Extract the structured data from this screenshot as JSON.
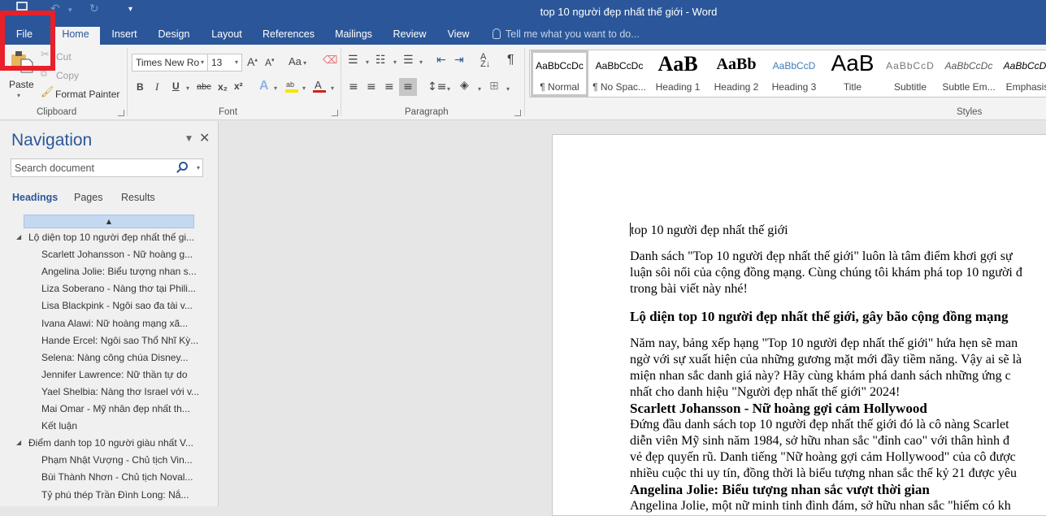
{
  "window": {
    "title": "top 10 người đẹp nhất thế giới - Word"
  },
  "quick_access": {
    "save_icon": "save-icon",
    "undo_icon": "undo-icon",
    "redo_icon": "redo-icon",
    "customize_icon": "customize-quick-access-icon"
  },
  "tabs": [
    {
      "label": "File",
      "active": false
    },
    {
      "label": "Home",
      "active": true
    },
    {
      "label": "Insert",
      "active": false
    },
    {
      "label": "Design",
      "active": false
    },
    {
      "label": "Layout",
      "active": false
    },
    {
      "label": "References",
      "active": false
    },
    {
      "label": "Mailings",
      "active": false
    },
    {
      "label": "Review",
      "active": false
    },
    {
      "label": "View",
      "active": false
    }
  ],
  "tell_me": {
    "placeholder": "Tell me what you want to do..."
  },
  "ribbon": {
    "clipboard": {
      "paste": "Paste",
      "cut": "Cut",
      "copy": "Copy",
      "format_painter": "Format Painter",
      "label": "Clipboard"
    },
    "font": {
      "font_name": "Times New Ro",
      "font_size": "13",
      "change_case": "Aa",
      "bold": "B",
      "italic": "I",
      "underline": "U",
      "strikethrough": "abc",
      "subscript": "x₂",
      "superscript": "x²",
      "highlight_color": "#f2e600",
      "font_color": "#d21f1f",
      "label": "Font"
    },
    "paragraph": {
      "label": "Paragraph",
      "show_marks": "¶"
    },
    "styles": {
      "label": "Styles",
      "items": [
        {
          "preview": "AaBbCcDc",
          "name": "¶ Normal",
          "selected": true
        },
        {
          "preview": "AaBbCcDc",
          "name": "¶ No Spac...",
          "selected": false
        },
        {
          "preview": "AaB",
          "name": "Heading 1",
          "selected": false
        },
        {
          "preview": "AaBb",
          "name": "Heading 2",
          "selected": false
        },
        {
          "preview": "AaBbCcD",
          "name": "Heading 3",
          "selected": false
        },
        {
          "preview": "AaB",
          "name": "Title",
          "selected": false
        },
        {
          "preview": "AaBbCcD",
          "name": "Subtitle",
          "selected": false
        },
        {
          "preview": "AaBbCcDc",
          "name": "Subtle Em...",
          "selected": false
        },
        {
          "preview": "AaBbCcDc",
          "name": "Emphasis",
          "selected": false
        }
      ]
    }
  },
  "navigation": {
    "title": "Navigation",
    "search_placeholder": "Search document",
    "tabs": [
      {
        "label": "Headings",
        "active": true
      },
      {
        "label": "Pages",
        "active": false
      },
      {
        "label": "Results",
        "active": false
      }
    ],
    "headings": [
      {
        "text": "Lộ diện top 10 người đẹp nhất thế gi...",
        "level": 1,
        "expanded": true
      },
      {
        "text": "Scarlett Johansson - Nữ hoàng g...",
        "level": 2
      },
      {
        "text": "Angelina Jolie: Biểu tượng nhan s...",
        "level": 2
      },
      {
        "text": "Liza Soberano - Nàng thơ tại Phili...",
        "level": 2
      },
      {
        "text": "Lisa Blackpink - Ngôi sao đa tài v...",
        "level": 2
      },
      {
        "text": "Ivana Alawi: Nữ hoàng mạng xã...",
        "level": 2
      },
      {
        "text": "Hande Ercel: Ngôi sao Thổ Nhĩ Kỳ...",
        "level": 2
      },
      {
        "text": "Selena: Nàng công chúa Disney...",
        "level": 2
      },
      {
        "text": "Jennifer Lawrence: Nữ thần tự do",
        "level": 2
      },
      {
        "text": "Yael Shelbia: Nàng thơ Israel với v...",
        "level": 2
      },
      {
        "text": "Mai Omar - Mỹ nhân đẹp nhất th...",
        "level": 2
      },
      {
        "text": "Kết luận",
        "level": 2
      },
      {
        "text": "Điểm danh top 10 người giàu nhất V...",
        "level": 1,
        "expanded": true
      },
      {
        "text": "Phạm Nhật Vượng - Chủ tịch Vin...",
        "level": 2
      },
      {
        "text": "Bùi Thành Nhơn - Chủ tịch Noval...",
        "level": 2
      },
      {
        "text": "Tỷ phú thép Trần Đình Long: Nắ...",
        "level": 2
      }
    ]
  },
  "document": {
    "title_line": "top 10 người đẹp nhất thế giới",
    "intro_lines": [
      "Danh sách \"Top 10 người đẹp nhất thế giới\" luôn là tâm điểm khơi gợi sự",
      "luận sôi nổi của cộng đồng mạng. Cùng chúng tôi khám phá top 10 người đ",
      "trong bài viết này nhé!"
    ],
    "heading1": "Lộ diện top 10 người đẹp nhất thế giới, gây bão cộng đồng mạng",
    "para2_lines": [
      "Năm nay, bảng xếp hạng \"Top 10 người đẹp nhất thế giới\" hứa hẹn sẽ man",
      "ngờ với sự xuất hiện của những gương mặt mới đầy tiềm năng. Vậy ai sẽ là",
      "miện nhan sắc danh giá này? Hãy cùng khám phá danh sách những ứng c",
      "nhất cho danh hiệu \"Người đẹp nhất thế giới\" 2024!"
    ],
    "heading2": "Scarlett Johansson - Nữ hoàng gợi cảm Hollywood",
    "para3_lines": [
      "Đứng đầu danh sách top 10 người đẹp nhất thế giới đó là cô nàng Scarlet",
      "diễn viên Mỹ sinh năm 1984, sở hữu nhan sắc \"đỉnh cao\" với thân hình đ",
      "vẻ đẹp quyến rũ. Danh tiếng \"Nữ hoàng gợi cảm Hollywood\" của cô được",
      "nhiều cuộc thi uy tín, đồng thời là biểu tượng nhan sắc thế kỷ 21 được yêu"
    ],
    "heading3": "Angelina Jolie: Biểu tượng nhan sắc vượt thời gian",
    "para4_lines": [
      "Angelina Jolie, một nữ minh tinh đình đám, sở hữu nhan sắc \"hiếm có kh"
    ]
  }
}
